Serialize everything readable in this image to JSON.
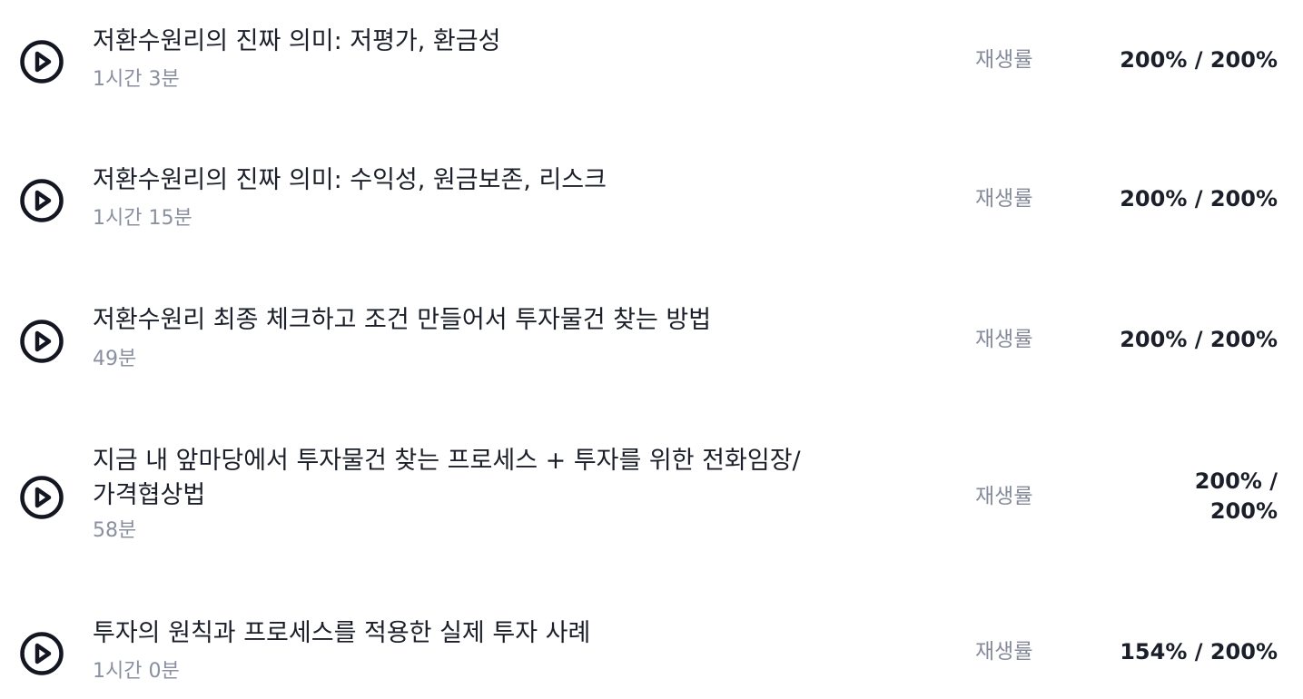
{
  "lectures": [
    {
      "title": "저환수원리의 진짜 의미: 저평가, 환금성",
      "duration": "1시간 3분",
      "progress_label": "재생률",
      "progress": "200% / 200%"
    },
    {
      "title": "저환수원리의 진짜 의미: 수익성, 원금보존, 리스크",
      "duration": "1시간 15분",
      "progress_label": "재생률",
      "progress": "200% / 200%"
    },
    {
      "title": "저환수원리 최종 체크하고 조건 만들어서 투자물건 찾는 방법",
      "duration": "49분",
      "progress_label": "재생률",
      "progress": "200% / 200%"
    },
    {
      "title_line1": "지금 내 앞마당에서 투자물건 찾는 프로세스 + 투자를 위한 전화임장/",
      "title_line2": "가격협상법",
      "duration": "58분",
      "progress_label": "재생률",
      "progress_line1": "200% /",
      "progress_line2": "200%"
    },
    {
      "title": "투자의 원칙과 프로세스를 적용한 실제 투자 사례",
      "duration": "1시간 0분",
      "progress_label": "재생률",
      "progress": "154% / 200%"
    }
  ],
  "icons": {
    "play": "play-circle-icon"
  },
  "colors": {
    "title": "#1b1f29",
    "muted": "#8a90a0"
  }
}
